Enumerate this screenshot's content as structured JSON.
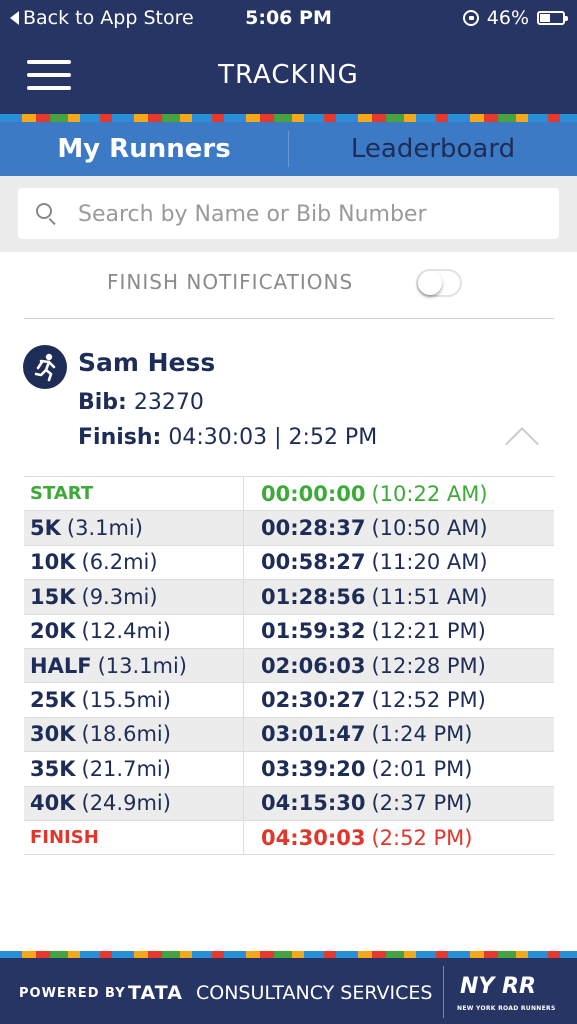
{
  "status_bar": {
    "back_label": "Back to App Store",
    "time": "5:06 PM",
    "battery_text": "46%",
    "battery_level": 0.46,
    "icons": [
      "back-arrow-icon",
      "rotation-lock-icon",
      "battery-icon"
    ]
  },
  "header": {
    "title": "TRACKING",
    "menu_icon": "hamburger-menu-icon"
  },
  "tabs": [
    {
      "label": "My Runners",
      "active": true
    },
    {
      "label": "Leaderboard",
      "active": false
    }
  ],
  "search": {
    "placeholder": "Search by Name or Bib Number",
    "value": "",
    "icon": "search-icon"
  },
  "notifications": {
    "label": "FINISH NOTIFICATIONS",
    "enabled": false
  },
  "runner": {
    "name": "Sam Hess",
    "bib_label": "Bib:",
    "bib": "23270",
    "finish_label": "Finish:",
    "finish_value": "04:30:03 | 2:52 PM",
    "icon": "runner-icon",
    "collapse_icon": "chevron-up-icon"
  },
  "splits": [
    {
      "dist": "START",
      "mi": "",
      "time": "00:00:00",
      "clock": "(10:22 AM)",
      "kind": "start"
    },
    {
      "dist": "5K",
      "mi": "(3.1mi)",
      "time": "00:28:37",
      "clock": "(10:50 AM)",
      "kind": "normal"
    },
    {
      "dist": "10K",
      "mi": "(6.2mi)",
      "time": "00:58:27",
      "clock": "(11:20 AM)",
      "kind": "normal"
    },
    {
      "dist": "15K",
      "mi": "(9.3mi)",
      "time": "01:28:56",
      "clock": "(11:51 AM)",
      "kind": "normal"
    },
    {
      "dist": "20K",
      "mi": "(12.4mi)",
      "time": "01:59:32",
      "clock": "(12:21 PM)",
      "kind": "normal"
    },
    {
      "dist": "HALF",
      "mi": "(13.1mi)",
      "time": "02:06:03",
      "clock": "(12:28 PM)",
      "kind": "normal"
    },
    {
      "dist": "25K",
      "mi": "(15.5mi)",
      "time": "02:30:27",
      "clock": "(12:52 PM)",
      "kind": "normal"
    },
    {
      "dist": "30K",
      "mi": "(18.6mi)",
      "time": "03:01:47",
      "clock": "(1:24 PM)",
      "kind": "normal"
    },
    {
      "dist": "35K",
      "mi": "(21.7mi)",
      "time": "03:39:20",
      "clock": "(2:01 PM)",
      "kind": "normal"
    },
    {
      "dist": "40K",
      "mi": "(24.9mi)",
      "time": "04:15:30",
      "clock": "(2:37 PM)",
      "kind": "normal"
    },
    {
      "dist": "FINISH",
      "mi": "",
      "time": "04:30:03",
      "clock": "(2:52 PM)",
      "kind": "finish"
    }
  ],
  "colors": {
    "navy": "#263564",
    "tab_blue": "#3d7ac6",
    "start_green": "#3daa3a",
    "finish_red": "#e0362c"
  },
  "footer": {
    "powered_by": "POWERED BY",
    "tata": "TATA",
    "tcs": "CONSULTANCY SERVICES",
    "nyrr_logo": "NY RR",
    "nyrr_sub": "NEW YORK ROAD RUNNERS"
  }
}
